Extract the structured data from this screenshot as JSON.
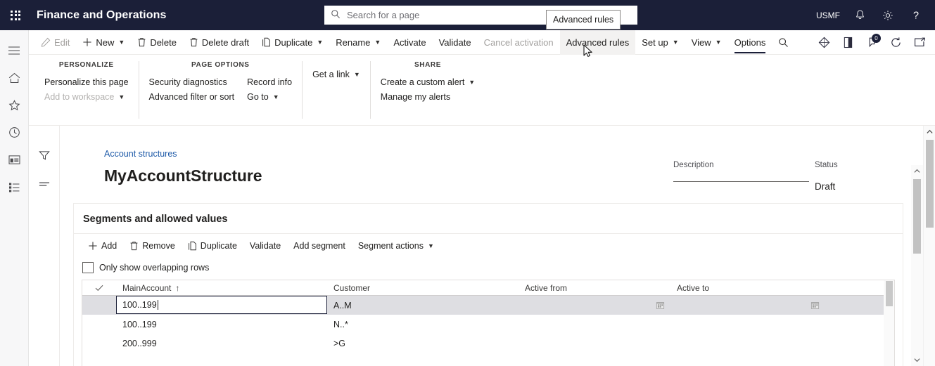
{
  "topbar": {
    "app_title": "Finance and Operations",
    "waffle_icon": "app-launcher-icon",
    "search": {
      "placeholder": "Search for a page",
      "icon": "search-icon"
    },
    "tooltip": "Advanced rules",
    "company": "USMF",
    "notifications_icon": "bell-icon",
    "settings_icon": "gear-icon",
    "help_icon": "question-mark-icon"
  },
  "rail": {
    "items": [
      {
        "name": "hamburger-menu-icon",
        "label": "Expand the navigation pane"
      },
      {
        "name": "home-icon",
        "label": "Home"
      },
      {
        "name": "star-icon",
        "label": "Favorites"
      },
      {
        "name": "clock-icon",
        "label": "Recent"
      },
      {
        "name": "workspaces-icon",
        "label": "Workspaces"
      },
      {
        "name": "modules-icon",
        "label": "Modules"
      }
    ]
  },
  "commandbar": {
    "items": [
      {
        "label": "Edit",
        "icon": "pencil-icon",
        "disabled": true,
        "caret": false,
        "state": ""
      },
      {
        "label": "New",
        "icon": "plus-icon",
        "disabled": false,
        "caret": true,
        "state": ""
      },
      {
        "label": "Delete",
        "icon": "trash-icon",
        "disabled": false,
        "caret": false,
        "state": ""
      },
      {
        "label": "Delete draft",
        "icon": "trash-icon",
        "disabled": false,
        "caret": false,
        "state": ""
      },
      {
        "label": "Duplicate",
        "icon": "copy-icon",
        "disabled": false,
        "caret": true,
        "state": ""
      },
      {
        "label": "Rename",
        "icon": "",
        "disabled": false,
        "caret": true,
        "state": ""
      },
      {
        "label": "Activate",
        "icon": "",
        "disabled": false,
        "caret": false,
        "state": ""
      },
      {
        "label": "Validate",
        "icon": "",
        "disabled": false,
        "caret": false,
        "state": ""
      },
      {
        "label": "Cancel activation",
        "icon": "",
        "disabled": true,
        "caret": false,
        "state": ""
      },
      {
        "label": "Advanced rules",
        "icon": "",
        "disabled": false,
        "caret": false,
        "state": "hovered"
      },
      {
        "label": "Set up",
        "icon": "",
        "disabled": false,
        "caret": true,
        "state": ""
      },
      {
        "label": "View",
        "icon": "",
        "disabled": false,
        "caret": true,
        "state": ""
      },
      {
        "label": "Options",
        "icon": "",
        "disabled": false,
        "caret": false,
        "state": "active"
      }
    ],
    "search_icon": "search-icon",
    "right_icons": [
      {
        "name": "diamond-icon"
      },
      {
        "name": "attachment-panel-icon"
      },
      {
        "name": "messages-icon",
        "badge": "0"
      },
      {
        "name": "refresh-icon"
      },
      {
        "name": "open-in-new-window-icon"
      }
    ]
  },
  "options_panel": {
    "groups": [
      {
        "heading": "PERSONALIZE",
        "columns": [
          [
            {
              "label": "Personalize this page",
              "caret": false,
              "disabled": false
            },
            {
              "label": "Add to workspace",
              "caret": true,
              "disabled": true
            }
          ]
        ]
      },
      {
        "heading": "PAGE OPTIONS",
        "columns": [
          [
            {
              "label": "Security diagnostics",
              "caret": false,
              "disabled": false
            },
            {
              "label": "Advanced filter or sort",
              "caret": false,
              "disabled": false
            }
          ],
          [
            {
              "label": "Record info",
              "caret": false,
              "disabled": false
            },
            {
              "label": "Go to",
              "caret": true,
              "disabled": false
            }
          ]
        ]
      },
      {
        "heading": "",
        "columns": [
          [
            {
              "label": "Get a link",
              "caret": true,
              "disabled": false
            }
          ]
        ]
      },
      {
        "heading": "SHARE",
        "columns": [
          [
            {
              "label": "Create a custom alert",
              "caret": true,
              "disabled": false
            },
            {
              "label": "Manage my alerts",
              "caret": false,
              "disabled": false
            }
          ]
        ]
      }
    ]
  },
  "page": {
    "filter_icon": "filter-icon",
    "list_icon": "show-list-icon",
    "breadcrumb": "Account structures",
    "title": "MyAccountStructure",
    "description": {
      "label": "Description",
      "value": ""
    },
    "status": {
      "label": "Status",
      "value": "Draft"
    }
  },
  "section": {
    "title": "Segments and allowed values",
    "toolbar": [
      {
        "label": "Add",
        "icon": "plus-icon",
        "caret": false
      },
      {
        "label": "Remove",
        "icon": "trash-icon",
        "caret": false
      },
      {
        "label": "Duplicate",
        "icon": "copy-icon",
        "caret": false
      },
      {
        "label": "Validate",
        "icon": "",
        "caret": false
      },
      {
        "label": "Add segment",
        "icon": "",
        "caret": false
      },
      {
        "label": "Segment actions",
        "icon": "",
        "caret": true
      }
    ],
    "overlap_checkbox": {
      "label": "Only show overlapping rows",
      "checked": false
    },
    "grid": {
      "columns": [
        {
          "key": "check",
          "label": "",
          "sort": ""
        },
        {
          "key": "main",
          "label": "MainAccount",
          "sort": "↑"
        },
        {
          "key": "customer",
          "label": "Customer",
          "sort": ""
        },
        {
          "key": "from",
          "label": "Active from",
          "sort": ""
        },
        {
          "key": "to",
          "label": "Active to",
          "sort": ""
        }
      ],
      "rows": [
        {
          "main": "100..199",
          "customer": "A..M",
          "from": "",
          "to": "",
          "selected": true,
          "editing": true,
          "calendar_icon": "calendar-icon"
        },
        {
          "main": "100..199",
          "customer": "N..*",
          "from": "",
          "to": "",
          "selected": false,
          "editing": false,
          "calendar_icon": ""
        },
        {
          "main": "200..999",
          "customer": ">G",
          "from": "",
          "to": "",
          "selected": false,
          "editing": false,
          "calendar_icon": ""
        }
      ]
    }
  },
  "colors": {
    "nav_bar": "#1b1f38",
    "link": "#1e5aa8",
    "selected_row": "#dedee2",
    "disabled_text": "#a19f9d"
  }
}
